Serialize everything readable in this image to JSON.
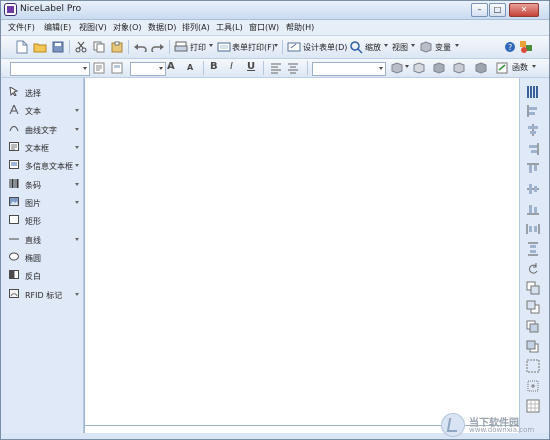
{
  "window": {
    "title": "NiceLabel Pro",
    "controls": {
      "minimize": "–",
      "restore": "□",
      "close": "✕"
    }
  },
  "menubar": {
    "items": [
      "文件(F)",
      "编辑(E)",
      "视图(V)",
      "对象(O)",
      "数据(D)",
      "排列(A)",
      "工具(L)",
      "窗口(W)",
      "帮助(H)"
    ]
  },
  "toolbar_main": {
    "print_label": "打印",
    "form_print_label": "表单打印(F)",
    "design_form_label": "设计表单(D)",
    "zoom_label": "缩放",
    "view_label": "视图",
    "variables_label": "变量"
  },
  "toolbar_format": {
    "bold": "B",
    "italic": "I",
    "underline": "U",
    "function_label": "函数"
  },
  "tools": [
    {
      "label": "选择",
      "icon": "pointer-icon",
      "has_menu": false
    },
    {
      "label": "文本",
      "icon": "text-icon",
      "has_menu": true
    },
    {
      "label": "曲线文字",
      "icon": "curved-text-icon",
      "has_menu": true
    },
    {
      "label": "文本框",
      "icon": "text-box-icon",
      "has_menu": true
    },
    {
      "label": "多信息文本框",
      "icon": "rich-text-icon",
      "has_menu": true
    },
    {
      "label": "条码",
      "icon": "barcode-icon",
      "has_menu": true
    },
    {
      "label": "图片",
      "icon": "picture-icon",
      "has_menu": true
    },
    {
      "label": "矩形",
      "icon": "rectangle-icon",
      "has_menu": false
    },
    {
      "label": "直线",
      "icon": "line-icon",
      "has_menu": true
    },
    {
      "label": "椭圆",
      "icon": "ellipse-icon",
      "has_menu": false
    },
    {
      "label": "反白",
      "icon": "inverse-icon",
      "has_menu": false
    },
    {
      "label": "RFID 标记",
      "icon": "rfid-icon",
      "has_menu": true
    }
  ],
  "watermark": {
    "name": "当下软件园",
    "url": "www.downxia.com"
  },
  "colors": {
    "title_gradient_top": "#e9f1fb",
    "title_gradient_bottom": "#c9dbf0",
    "panel": "#dfe9f7",
    "canvas": "#ffffff",
    "close_button": "#c44237"
  }
}
